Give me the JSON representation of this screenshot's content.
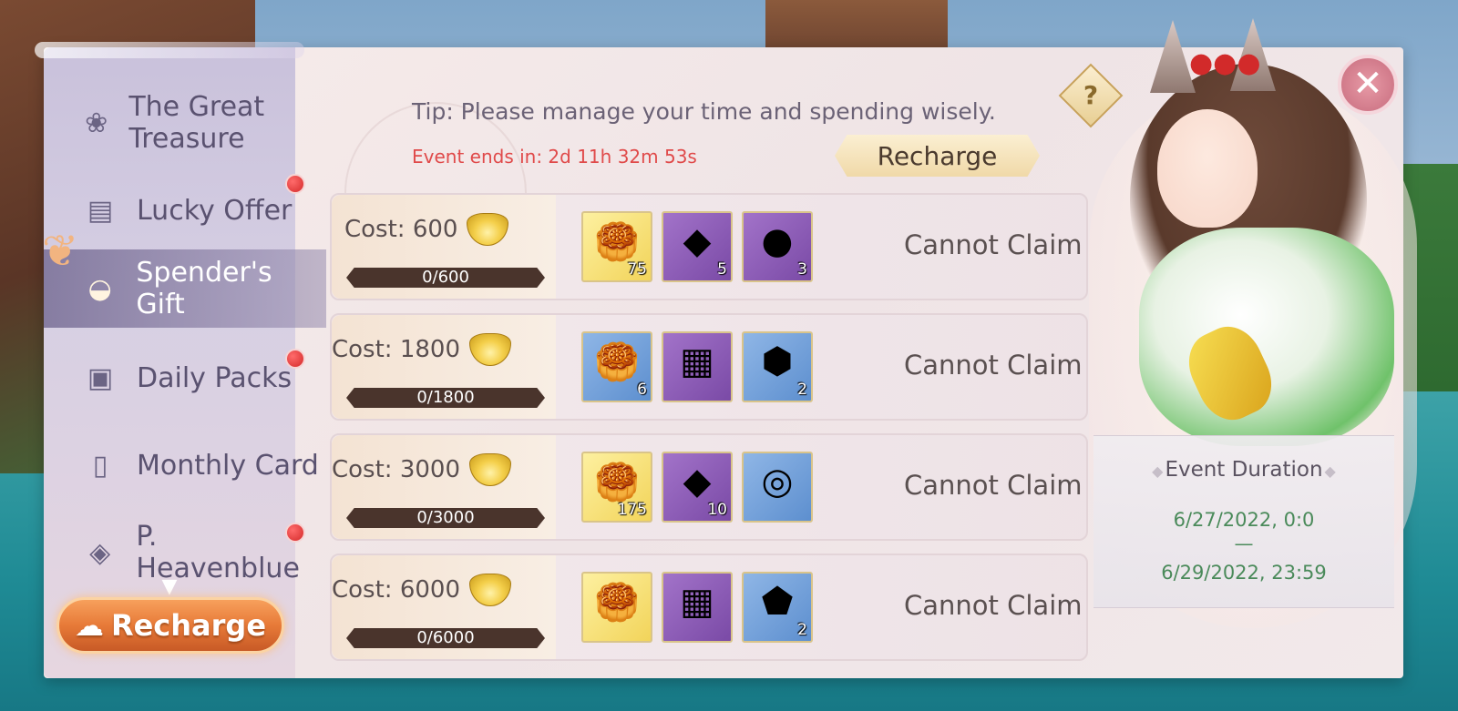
{
  "sidebar": {
    "items": [
      {
        "label": "The Great Treasure",
        "icon": "lotus-icon",
        "badge": false,
        "active": false
      },
      {
        "label": "Lucky Offer",
        "icon": "ticket-icon",
        "badge": true,
        "active": false
      },
      {
        "label": "Spender's Gift",
        "icon": "gold-ingot-icon",
        "badge": false,
        "active": true
      },
      {
        "label": "Daily Packs",
        "icon": "gift-box-icon",
        "badge": true,
        "active": false
      },
      {
        "label": "Monthly Card",
        "icon": "card-icon",
        "badge": false,
        "active": false
      },
      {
        "label": "P. Heavenblue",
        "icon": "shield-icon",
        "badge": true,
        "active": false
      }
    ],
    "recharge_label": "Recharge"
  },
  "header": {
    "tip": "Tip: Please manage your time and spending wisely.",
    "countdown": "Event ends in: 2d 11h 32m 53s",
    "recharge_label": "Recharge",
    "help_label": "?",
    "close_label": "✕"
  },
  "tiers": [
    {
      "cost": "Cost: 600",
      "progress": "0/600",
      "status": "Cannot Claim",
      "rewards": [
        {
          "type": "gold-ingot",
          "bg": "gold",
          "qty": "75"
        },
        {
          "type": "crystal-cluster",
          "bg": "purple",
          "qty": "5"
        },
        {
          "type": "dark-egg",
          "bg": "purple",
          "qty": "3"
        }
      ]
    },
    {
      "cost": "Cost: 1800",
      "progress": "0/1800",
      "status": "Cannot Claim",
      "rewards": [
        {
          "type": "gold-ingot",
          "bg": "blue",
          "qty": "6"
        },
        {
          "type": "treasure-chest",
          "bg": "purple",
          "qty": ""
        },
        {
          "type": "amber-gem",
          "bg": "blue",
          "qty": "2"
        }
      ]
    },
    {
      "cost": "Cost: 3000",
      "progress": "0/3000",
      "status": "Cannot Claim",
      "rewards": [
        {
          "type": "gold-ingot",
          "bg": "gold",
          "qty": "175"
        },
        {
          "type": "crystal-cluster",
          "bg": "purple",
          "qty": "10"
        },
        {
          "type": "silver-coin",
          "bg": "blue",
          "qty": ""
        }
      ]
    },
    {
      "cost": "Cost: 6000",
      "progress": "0/6000",
      "status": "Cannot Claim",
      "rewards": [
        {
          "type": "gold-ingot",
          "bg": "gold",
          "qty": ""
        },
        {
          "type": "treasure-chest",
          "bg": "purple",
          "qty": ""
        },
        {
          "type": "rune-stone",
          "bg": "blue",
          "qty": "2"
        }
      ]
    }
  ],
  "event": {
    "duration_title": "Event Duration",
    "start": "6/27/2022, 0:0",
    "separator": "—",
    "end": "6/29/2022, 23:59"
  },
  "colors": {
    "countdown": "#e04a4a",
    "duration_dates": "#4a8a5a",
    "badge": "#d42a2a"
  }
}
